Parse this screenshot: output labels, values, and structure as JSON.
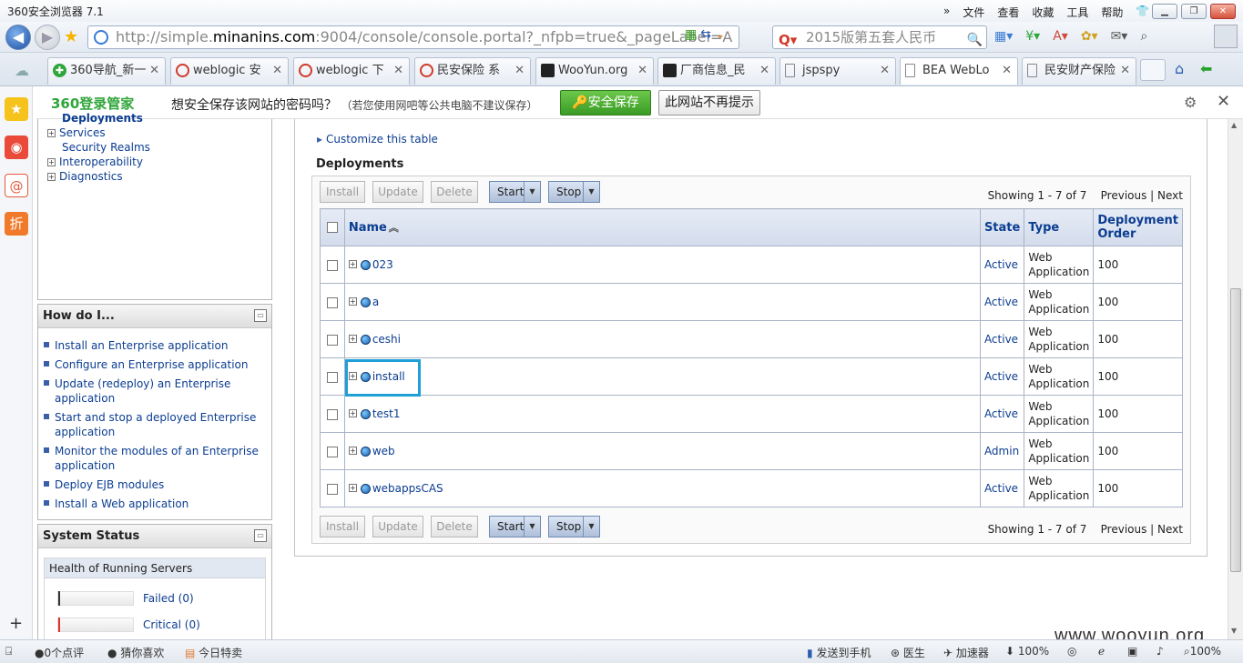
{
  "browser": {
    "title": "360安全浏览器 7.1",
    "menus": [
      "文件",
      "查看",
      "收藏",
      "工具",
      "帮助"
    ],
    "url_prefix": "http://simple.",
    "url_host": "minanins.com",
    "url_rest": ":9004/console/console.portal?_nfpb=true&_pageLabel=A",
    "search_text": "2015版第五套人民币",
    "tabs": [
      {
        "label": "360导航_新一",
        "icon": "360-nav-icon"
      },
      {
        "label": "weblogic 安",
        "icon": "search-q-icon"
      },
      {
        "label": "weblogic 下",
        "icon": "search-q-icon"
      },
      {
        "label": "民安保险 系",
        "icon": "search-q-icon"
      },
      {
        "label": "WooYun.org",
        "icon": "wooyun-icon"
      },
      {
        "label": "厂商信息_民",
        "icon": "wooyun-icon"
      },
      {
        "label": "jspspy",
        "icon": "page-icon"
      },
      {
        "label": "BEA WebLo",
        "icon": "page-icon"
      },
      {
        "label": "民安财产保险",
        "icon": "page-icon"
      }
    ]
  },
  "notify": {
    "brand": "360登录管家",
    "message": "想安全保存该网站的密码吗？",
    "note": "（若您使用网吧等公共电脑不建议保存）",
    "save_label": "安全保存",
    "never_label": "此网站不再提示"
  },
  "tree": {
    "items": [
      "Deployments",
      "Services",
      "Security Realms",
      "Interoperability",
      "Diagnostics"
    ]
  },
  "howdo": {
    "title": "How do I...",
    "links": [
      "Install an Enterprise application",
      "Configure an Enterprise application",
      "Update (redeploy) an Enterprise application",
      "Start and stop a deployed Enterprise application",
      "Monitor the modules of an Enterprise application",
      "Deploy EJB modules",
      "Install a Web application"
    ]
  },
  "sysstatus": {
    "title": "System Status",
    "health_title": "Health of Running Servers",
    "failed": "Failed (0)",
    "critical": "Critical (0)"
  },
  "main": {
    "customize": "Customize this table",
    "title": "Deployments",
    "buttons": {
      "install": "Install",
      "update": "Update",
      "delete": "Delete",
      "start": "Start",
      "stop": "Stop"
    },
    "showing": "Showing 1 - 7 of 7",
    "previous": "Previous",
    "next": "Next",
    "columns": {
      "name": "Name",
      "state": "State",
      "type": "Type",
      "order": "Deployment Order"
    },
    "rows": [
      {
        "name": "023",
        "state": "Active",
        "type": "Web Application",
        "order": "100"
      },
      {
        "name": "a",
        "state": "Active",
        "type": "Web Application",
        "order": "100"
      },
      {
        "name": "ceshi",
        "state": "Active",
        "type": "Web Application",
        "order": "100"
      },
      {
        "name": "install",
        "state": "Active",
        "type": "Web Application",
        "order": "100"
      },
      {
        "name": "test1",
        "state": "Active",
        "type": "Web Application",
        "order": "100"
      },
      {
        "name": "web",
        "state": "Admin",
        "type": "Web Application",
        "order": "100"
      },
      {
        "name": "webappsCAS",
        "state": "Active",
        "type": "Web Application",
        "order": "100"
      }
    ]
  },
  "watermark": "www.wooyun.org",
  "statusbar": {
    "comments": "0个点评",
    "guess": "猜你喜欢",
    "deals": "今日特卖",
    "send": "发送到手机",
    "doctor": "医生",
    "accelerate": "加速器",
    "download": "100%",
    "zoom": "100%"
  }
}
